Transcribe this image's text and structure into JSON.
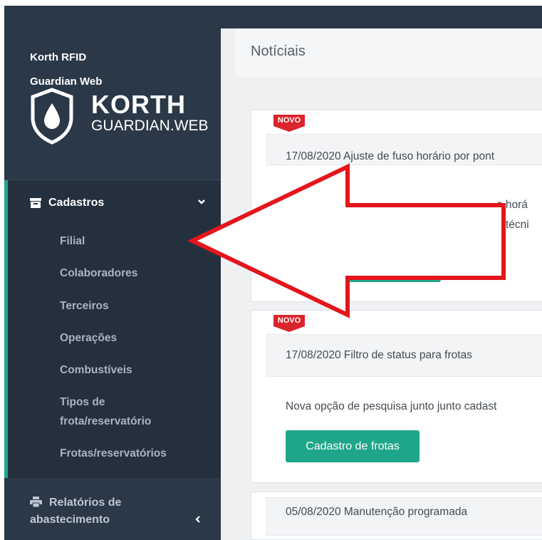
{
  "brand": {
    "line1": "Korth RFID",
    "line2": "Guardian Web",
    "logo_word1": "KORTH",
    "logo_word2": "GUARDIAN.WEB"
  },
  "sidebar": {
    "cadastros": {
      "label": "Cadastros",
      "icon": "archive-box-icon",
      "items": [
        {
          "label": "Filial"
        },
        {
          "label": "Colaboradores"
        },
        {
          "label": "Terceiros"
        },
        {
          "label": "Operações"
        },
        {
          "label": "Combustíveis"
        },
        {
          "label": "Tipos de"
        },
        {
          "label": "frota/reservatório"
        },
        {
          "label": "Frotas/reservatórios"
        }
      ]
    },
    "relatorios": {
      "line1": "Relatórios de",
      "line2": "abastecimento",
      "icon": "printer-icon"
    }
  },
  "main": {
    "title": "Notíciais",
    "news": [
      {
        "badge": "NOVO",
        "title": "17/08/2020 Ajuste de fuso horário por pont",
        "body_line1": "o horá",
        "body_line2": "o técni"
      },
      {
        "badge": "NOVO",
        "title": "17/08/2020 Filtro de status para frotas",
        "body": "Nova opção de pesquisa junto junto cadast",
        "button": "Cadastro de frotas"
      },
      {
        "title": "05/08/2020 Manutenção programada"
      }
    ]
  },
  "colors": {
    "sidebar": "#2b3848",
    "accent": "#1fa68a",
    "badge": "#d9252b",
    "arrow": "#e3161c"
  }
}
